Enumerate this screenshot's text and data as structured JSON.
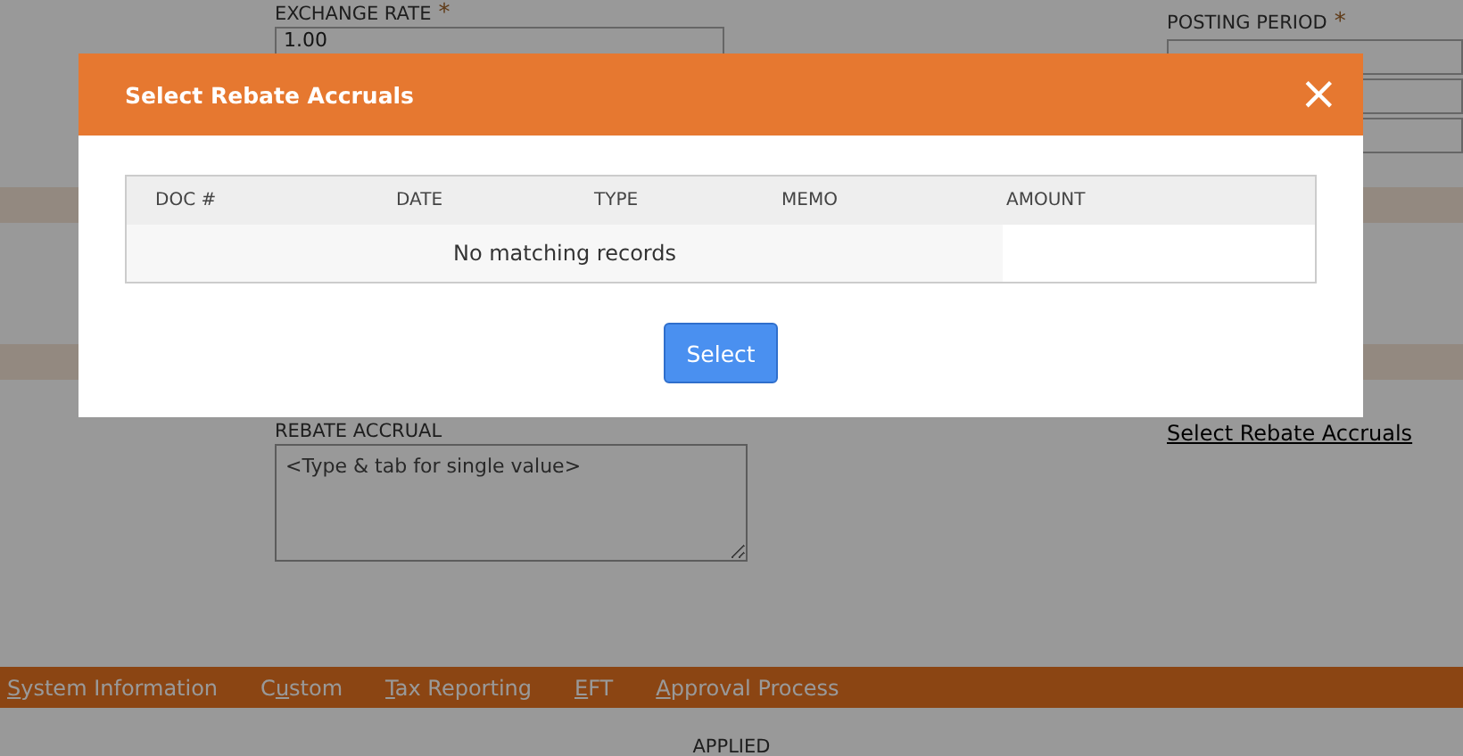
{
  "form": {
    "exchange_rate": {
      "label": "EXCHANGE RATE",
      "required_mark": "*",
      "value": "1.00"
    },
    "posting_period": {
      "label": "POSTING PERIOD",
      "required_mark": "*"
    },
    "rebate_accrual": {
      "label": "REBATE ACCRUAL",
      "placeholder": "<Type & tab for single value>"
    },
    "link": "Select Rebate Accruals"
  },
  "tabs": [
    {
      "key": "S",
      "after": "ystem Information"
    },
    {
      "before": "C",
      "key": "u",
      "after": "stom"
    },
    {
      "key": "T",
      "after": "ax Reporting"
    },
    {
      "key": "E",
      "after": "FT"
    },
    {
      "key": "A",
      "after": "pproval Process"
    }
  ],
  "applied_heading": "APPLIED",
  "dialog": {
    "title": "Select Rebate Accruals",
    "close": "×",
    "columns": [
      "DOC #",
      "DATE",
      "TYPE",
      "MEMO",
      "AMOUNT"
    ],
    "empty_message": "No matching records",
    "button": "Select"
  }
}
